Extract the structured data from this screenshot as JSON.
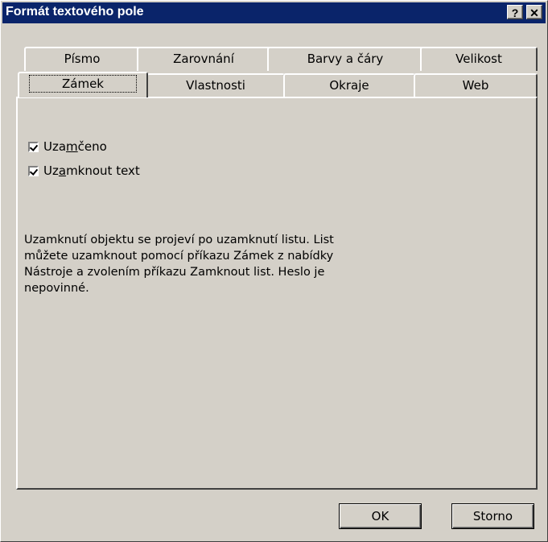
{
  "window": {
    "title": "Formát textového pole",
    "help_label": "?",
    "close_label": "✕"
  },
  "tabs_back_row": [
    {
      "label": "Písmo"
    },
    {
      "label": "Zarovnání"
    },
    {
      "label": "Barvy a čáry"
    },
    {
      "label": "Velikost"
    }
  ],
  "tabs_front_row": [
    {
      "label": "Zámek",
      "active": true
    },
    {
      "label": "Vlastnosti"
    },
    {
      "label": "Okraje"
    },
    {
      "label": "Web"
    }
  ],
  "panel": {
    "locked": {
      "pre": "Uza",
      "accel": "m",
      "post": "čeno",
      "checked": true
    },
    "lock_text": {
      "pre": "Uz",
      "accel": "a",
      "post": "mknout text",
      "checked": true
    },
    "info_lines": [
      "Uzamknutí objektu se projeví po uzamknutí listu. List",
      "můžete uzamknout pomocí příkazu Zámek z nabídky",
      "Nástroje a zvolením příkazu Zamknout list. Heslo je",
      "nepovinné."
    ]
  },
  "buttons": {
    "ok": "OK",
    "cancel": "Storno"
  }
}
